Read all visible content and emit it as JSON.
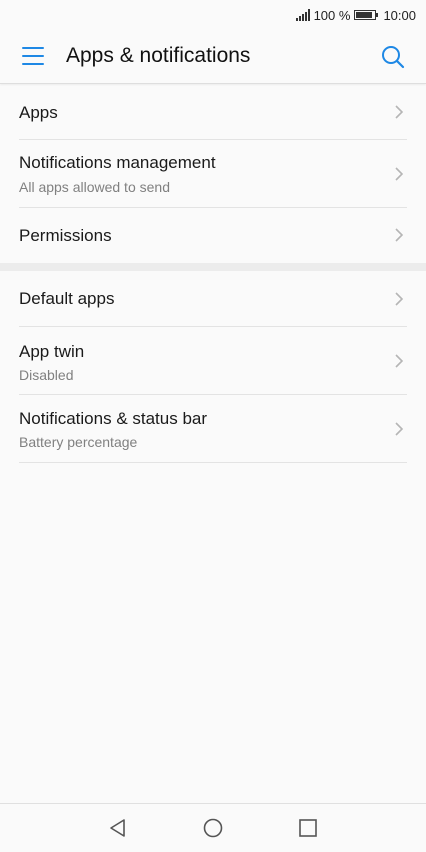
{
  "status_bar": {
    "battery_text": "100 %",
    "time": "10:00"
  },
  "header": {
    "title": "Apps & notifications",
    "menu_icon": "hamburger-menu-icon",
    "search_icon": "search-icon"
  },
  "section1": {
    "items": [
      {
        "label": "Apps"
      },
      {
        "label": "Notifications management",
        "sub": "All apps allowed to send"
      },
      {
        "label": "Permissions"
      }
    ]
  },
  "section2": {
    "items": [
      {
        "label": "Default apps"
      },
      {
        "label": "App twin",
        "sub": "Disabled"
      },
      {
        "label": "Notifications & status bar",
        "sub": "Battery percentage"
      }
    ]
  },
  "nav": {
    "back_icon": "back-triangle-icon",
    "home_icon": "home-circle-icon",
    "recents_icon": "recents-square-icon"
  },
  "colors": {
    "accent": "#1e88e5",
    "background": "#fafafa",
    "section_gap": "#ececec"
  }
}
